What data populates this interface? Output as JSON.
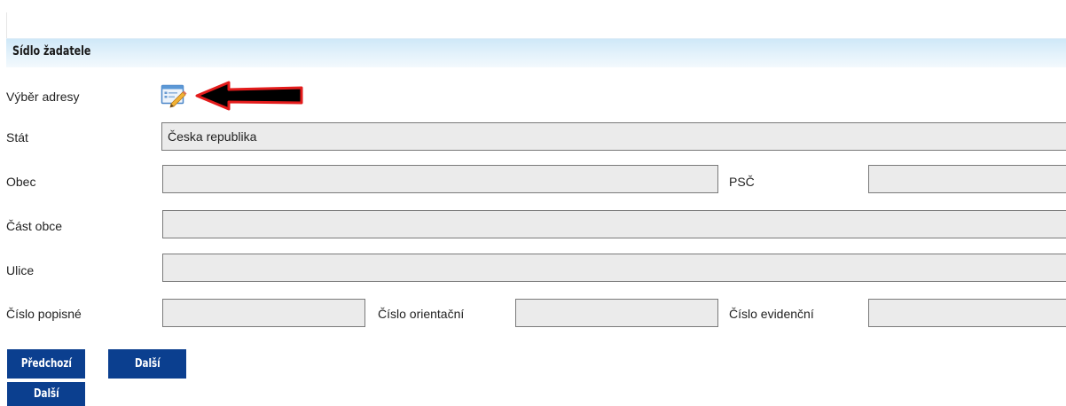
{
  "section": {
    "title": "Sídlo žadatele"
  },
  "address_picker": {
    "label": "Výběr adresy",
    "icon": "edit-address-form-icon",
    "annotation": "red-arrow-pointing-left"
  },
  "form": {
    "stat": {
      "label": "Stát",
      "value": "Česka republika"
    },
    "obec": {
      "label": "Obec",
      "value": ""
    },
    "psc": {
      "label": "PSČ",
      "value": ""
    },
    "cast_obce": {
      "label": "Část obce",
      "value": ""
    },
    "ulice": {
      "label": "Ulice",
      "value": ""
    },
    "cislo_popisne": {
      "label": "Číslo popisné",
      "value": ""
    },
    "cislo_orientacni": {
      "label": "Číslo orientační",
      "value": ""
    },
    "cislo_evidencni": {
      "label": "Číslo evidenční",
      "value": ""
    }
  },
  "buttons": {
    "previous": "Předchozí",
    "next_top": "Další",
    "next_bottom": "Další"
  },
  "colors": {
    "button_bg": "#0b3f8f",
    "field_bg": "#ebebeb",
    "header_bg": "#d6ecf9",
    "annotation_arrow": "#e31b1b"
  }
}
